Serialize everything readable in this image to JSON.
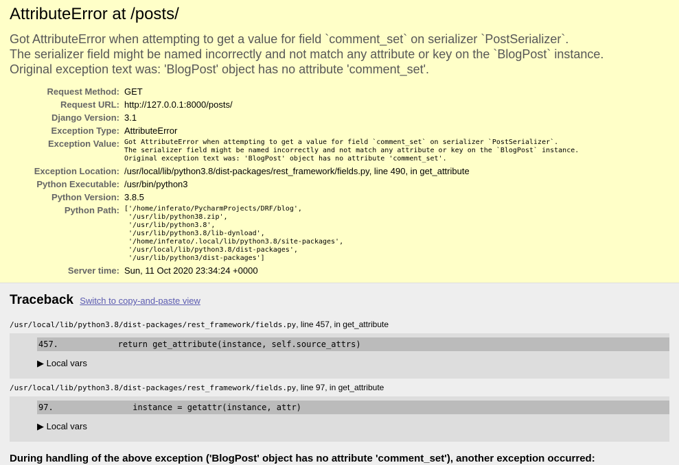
{
  "title": "AttributeError at /posts/",
  "exception_lines": [
    "Got AttributeError when attempting to get a value for field `comment_set` on serializer `PostSerializer`.",
    "The serializer field might be named incorrectly and not match any attribute or key on the `BlogPost` instance.",
    "Original exception text was: 'BlogPost' object has no attribute 'comment_set'."
  ],
  "meta": {
    "request_method": {
      "label": "Request Method:",
      "value": "GET"
    },
    "request_url": {
      "label": "Request URL:",
      "value": "http://127.0.0.1:8000/posts/"
    },
    "django_version": {
      "label": "Django Version:",
      "value": "3.1"
    },
    "exception_type": {
      "label": "Exception Type:",
      "value": "AttributeError"
    },
    "exception_value": {
      "label": "Exception Value:",
      "value": "Got AttributeError when attempting to get a value for field `comment_set` on serializer `PostSerializer`.\nThe serializer field might be named incorrectly and not match any attribute or key on the `BlogPost` instance.\nOriginal exception text was: 'BlogPost' object has no attribute 'comment_set'."
    },
    "exception_location": {
      "label": "Exception Location:",
      "value": "/usr/local/lib/python3.8/dist-packages/rest_framework/fields.py, line 490, in get_attribute"
    },
    "python_executable": {
      "label": "Python Executable:",
      "value": "/usr/bin/python3"
    },
    "python_version": {
      "label": "Python Version:",
      "value": "3.8.5"
    },
    "python_path": {
      "label": "Python Path:",
      "value": "['/home/inferato/PycharmProjects/DRF/blog',\n '/usr/lib/python38.zip',\n '/usr/lib/python3.8',\n '/usr/lib/python3.8/lib-dynload',\n '/home/inferato/.local/lib/python3.8/site-packages',\n '/usr/local/lib/python3.8/dist-packages',\n '/usr/lib/python3/dist-packages']"
    },
    "server_time": {
      "label": "Server time:",
      "value": "Sun, 11 Oct 2020 23:34:24 +0000"
    }
  },
  "traceback": {
    "heading": "Traceback",
    "switch_link": "Switch to copy-and-paste view",
    "frames": [
      {
        "file": "/usr/local/lib/python3.8/dist-packages/rest_framework/fields.py",
        "location": ", line 457, in get_attribute",
        "code": "457.            return get_attribute(instance, self.source_attrs)",
        "vars_label": "▶ Local vars"
      },
      {
        "file": "/usr/local/lib/python3.8/dist-packages/rest_framework/fields.py",
        "location": ", line 97, in get_attribute",
        "code": "97.                instance = getattr(instance, attr)",
        "vars_label": "▶ Local vars"
      }
    ]
  },
  "during_text": "During handling of the above exception ('BlogPost' object has no attribute 'comment_set'), another exception occurred:"
}
